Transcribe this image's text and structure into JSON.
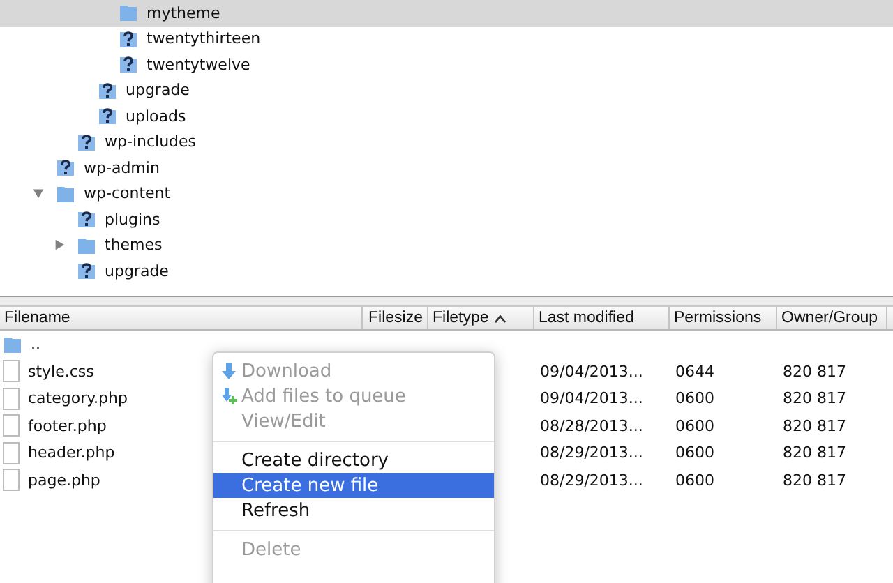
{
  "tree": {
    "items": [
      {
        "children": [
          {
            "children": [
              {
                "children": [
                  {
                    "label": "mytheme",
                    "kind": "folder",
                    "selected": true
                  },
                  {
                    "label": "twentythirteen",
                    "kind": "unknown",
                    "selected": false
                  },
                  {
                    "label": "twentytwelve",
                    "kind": "unknown",
                    "selected": false
                  }
                ]
              },
              {
                "label": "upgrade",
                "kind": "unknown",
                "selected": false
              },
              {
                "label": "uploads",
                "kind": "unknown",
                "selected": false
              }
            ]
          },
          {
            "label": "wp-includes",
            "kind": "unknown",
            "selected": false
          }
        ]
      },
      {
        "label": "wp-admin",
        "kind": "unknown",
        "selected": false
      },
      {
        "label": "wp-content",
        "kind": "folder",
        "selected": false,
        "expanded": true,
        "children": [
          {
            "label": "plugins",
            "kind": "unknown",
            "selected": false
          },
          {
            "label": "themes",
            "kind": "folder",
            "selected": false,
            "expanded": false
          },
          {
            "label": "upgrade",
            "kind": "unknown",
            "selected": false
          }
        ]
      }
    ]
  },
  "files": {
    "columns": [
      {
        "label": "Filename",
        "sorted": false
      },
      {
        "label": "Filesize",
        "sorted": false
      },
      {
        "label": "Filetype",
        "sorted": true
      },
      {
        "label": "Last modified",
        "sorted": false
      },
      {
        "label": "Permissions",
        "sorted": false
      },
      {
        "label": "Owner/Group",
        "sorted": false
      }
    ],
    "rows": [
      {
        "kind": "folder",
        "name": "..",
        "modified": "",
        "permissions": "",
        "owner": ""
      },
      {
        "kind": "file",
        "name": "style.css",
        "modified": "09/04/2013...",
        "permissions": "0644",
        "owner": "820 817"
      },
      {
        "kind": "file",
        "name": "category.php",
        "modified": "09/04/2013...",
        "permissions": "0600",
        "owner": "820 817"
      },
      {
        "kind": "file",
        "name": "footer.php",
        "modified": "08/28/2013...",
        "permissions": "0600",
        "owner": "820 817"
      },
      {
        "kind": "file",
        "name": "header.php",
        "modified": "08/29/2013...",
        "permissions": "0600",
        "owner": "820 817"
      },
      {
        "kind": "file",
        "name": "page.php",
        "modified": "08/29/2013...",
        "permissions": "0600",
        "owner": "820 817"
      }
    ]
  },
  "context_menu": {
    "items": [
      {
        "kind": "download",
        "label": "Download",
        "disabled": true,
        "selected": false
      },
      {
        "kind": "queue",
        "label": "Add files to queue",
        "disabled": true,
        "selected": false
      },
      {
        "kind": "item",
        "label": "View/Edit",
        "disabled": true,
        "selected": false
      },
      {
        "kind": "separator"
      },
      {
        "kind": "item",
        "label": "Create directory",
        "disabled": false,
        "selected": false
      },
      {
        "kind": "item",
        "label": "Create new file",
        "disabled": false,
        "selected": true
      },
      {
        "kind": "item",
        "label": "Refresh",
        "disabled": false,
        "selected": false
      },
      {
        "kind": "separator"
      },
      {
        "kind": "item",
        "label": "Delete",
        "disabled": true,
        "selected": false
      }
    ]
  }
}
